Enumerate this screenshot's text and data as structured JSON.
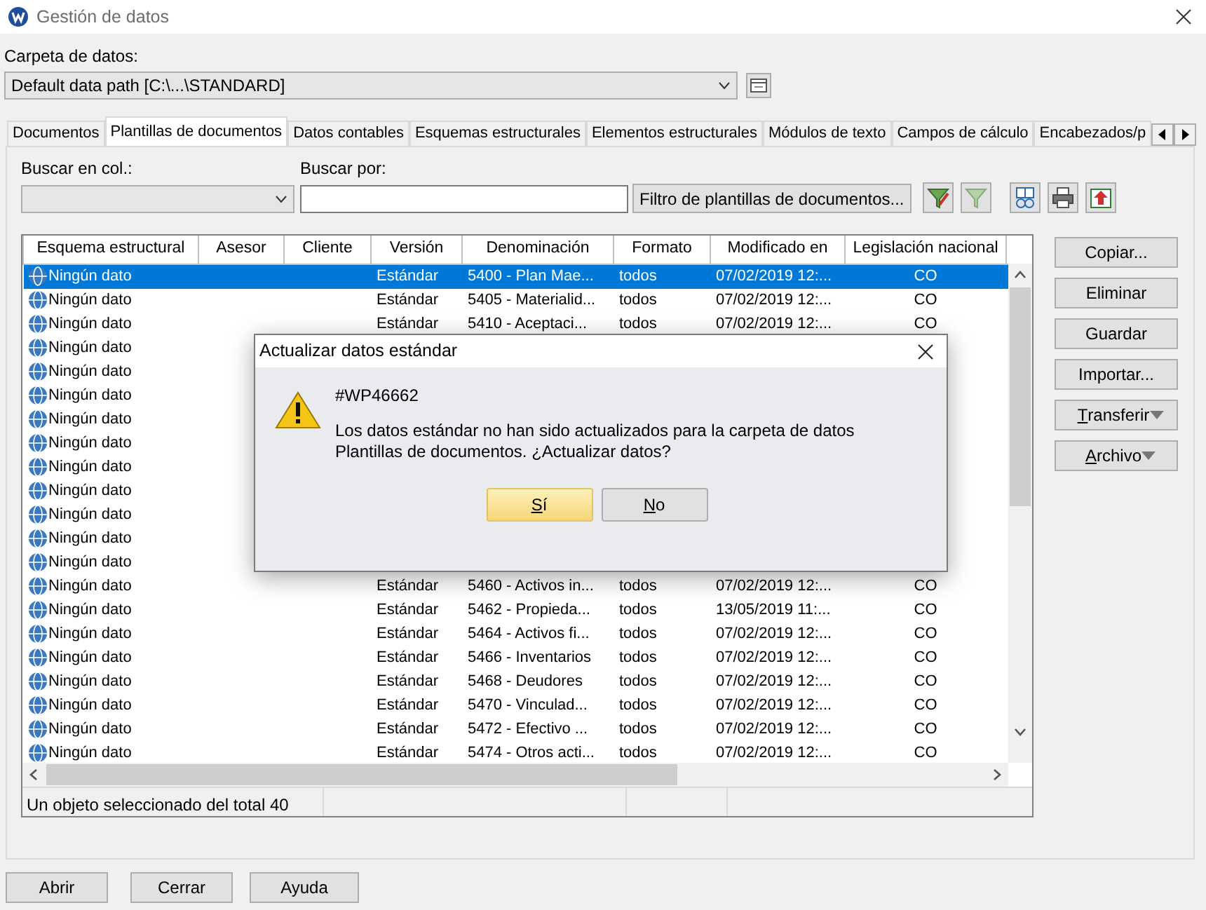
{
  "window": {
    "title": "Gestión de datos"
  },
  "data_folder": {
    "label": "Carpeta de datos:",
    "value": "Default data path [C:\\...\\STANDARD]"
  },
  "tabs": [
    {
      "label": "Documentos",
      "selected": false
    },
    {
      "label": "Plantillas de documentos",
      "selected": true
    },
    {
      "label": "Datos contables",
      "selected": false
    },
    {
      "label": "Esquemas estructurales",
      "selected": false
    },
    {
      "label": "Elementos estructurales",
      "selected": false
    },
    {
      "label": "Módulos de texto",
      "selected": false
    },
    {
      "label": "Campos de cálculo",
      "selected": false
    },
    {
      "label": "Encabezados/p",
      "selected": false
    }
  ],
  "search": {
    "column_label": "Buscar en col.:",
    "by_label": "Buscar por:",
    "filter_button": "Filtro de plantillas de documentos..."
  },
  "table": {
    "columns": [
      "Esquema estructural",
      "Asesor",
      "Cliente",
      "Versión",
      "Denominación",
      "Formato",
      "Modificado en",
      "Legislación nacional"
    ],
    "rows": [
      {
        "selected": true,
        "cells": [
          "Ningún dato",
          "",
          "",
          "Estándar",
          "5400 - Plan Mae...",
          "todos",
          "07/02/2019 12:...",
          "CO"
        ]
      },
      {
        "selected": false,
        "cells": [
          "Ningún dato",
          "",
          "",
          "Estándar",
          "5405 - Materialid...",
          "todos",
          "07/02/2019 12:...",
          "CO"
        ]
      },
      {
        "selected": false,
        "cells": [
          "Ningún dato",
          "",
          "",
          "Estándar",
          "5410 - Aceptaci...",
          "todos",
          "07/02/2019 12:...",
          "CO"
        ]
      },
      {
        "selected": false,
        "cells": [
          "Ningún dato"
        ]
      },
      {
        "selected": false,
        "cells": [
          "Ningún dato"
        ]
      },
      {
        "selected": false,
        "cells": [
          "Ningún dato"
        ]
      },
      {
        "selected": false,
        "cells": [
          "Ningún dato"
        ]
      },
      {
        "selected": false,
        "cells": [
          "Ningún dato"
        ]
      },
      {
        "selected": false,
        "cells": [
          "Ningún dato"
        ]
      },
      {
        "selected": false,
        "cells": [
          "Ningún dato"
        ]
      },
      {
        "selected": false,
        "cells": [
          "Ningún dato"
        ]
      },
      {
        "selected": false,
        "cells": [
          "Ningún dato"
        ]
      },
      {
        "selected": false,
        "cells": [
          "Ningún dato"
        ]
      },
      {
        "selected": false,
        "cells": [
          "Ningún dato",
          "",
          "",
          "Estándar",
          "5460 - Activos in...",
          "todos",
          "07/02/2019 12:...",
          "CO"
        ]
      },
      {
        "selected": false,
        "cells": [
          "Ningún dato",
          "",
          "",
          "Estándar",
          "5462 - Propieda...",
          "todos",
          "13/05/2019 11:...",
          "CO"
        ]
      },
      {
        "selected": false,
        "cells": [
          "Ningún dato",
          "",
          "",
          "Estándar",
          "5464 - Activos fi...",
          "todos",
          "07/02/2019 12:...",
          "CO"
        ]
      },
      {
        "selected": false,
        "cells": [
          "Ningún dato",
          "",
          "",
          "Estándar",
          "5466 - Inventarios",
          "todos",
          "07/02/2019 12:...",
          "CO"
        ]
      },
      {
        "selected": false,
        "cells": [
          "Ningún dato",
          "",
          "",
          "Estándar",
          "5468 - Deudores",
          "todos",
          "07/02/2019 12:...",
          "CO"
        ]
      },
      {
        "selected": false,
        "cells": [
          "Ningún dato",
          "",
          "",
          "Estándar",
          "5470 - Vinculad...",
          "todos",
          "07/02/2019 12:...",
          "CO"
        ]
      },
      {
        "selected": false,
        "cells": [
          "Ningún dato",
          "",
          "",
          "Estándar",
          "5472 - Efectivo ...",
          "todos",
          "07/02/2019 12:...",
          "CO"
        ]
      },
      {
        "selected": false,
        "cells": [
          "Ningún dato",
          "",
          "",
          "Estándar",
          "5474 - Otros acti...",
          "todos",
          "07/02/2019 12:...",
          "CO"
        ]
      }
    ],
    "status_bar": "Un objeto seleccionado del total 40"
  },
  "side_buttons": [
    {
      "label": "Copiar...",
      "kind": "plain",
      "mnemonic": false
    },
    {
      "label": "Eliminar",
      "kind": "plain",
      "mnemonic": false
    },
    {
      "label": "Guardar",
      "kind": "plain",
      "mnemonic": false
    },
    {
      "label": "Importar...",
      "kind": "plain",
      "mnemonic": false
    },
    {
      "label": "Transferir",
      "kind": "dropdown",
      "mnemonic": true
    },
    {
      "label": "Archivo",
      "kind": "dropdown",
      "mnemonic": true
    }
  ],
  "bottom_buttons": [
    "Abrir",
    "Cerrar",
    "Ayuda"
  ],
  "dialog": {
    "title": "Actualizar datos estándar",
    "code": "#WP46662",
    "message": "Los datos estándar no han sido actualizados para la carpeta de datos Plantillas de documentos. ¿Actualizar datos?",
    "buttons": [
      {
        "label": "Sí",
        "default": true,
        "mnemonic": true
      },
      {
        "label": "No",
        "default": false,
        "mnemonic": true
      }
    ]
  }
}
